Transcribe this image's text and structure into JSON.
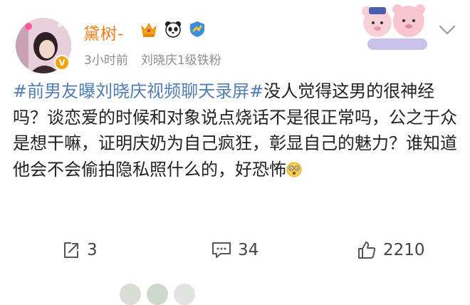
{
  "user": {
    "name": "黛树-",
    "time": "3小时前",
    "fan_label": "刘晓庆1级铁粉"
  },
  "post": {
    "hashtag": "#前男友曝刘晓庆视频聊天录屏#",
    "body": "没人觉得这男的很神经吗？谈恋爱的时候和对象说点烧话不是很正常吗，公之于众是想干嘛，证明庆奶为自己疯狂，彰显自己的魅力？谁知道他会不会偷拍隐私照什么的，好恐怖"
  },
  "actions": {
    "share_count": "3",
    "comment_count": "34",
    "like_count": "2210"
  },
  "icons": [
    "crown-icon",
    "panda-icon",
    "verified-shield-icon",
    "chevron-down-icon",
    "share-icon",
    "comment-icon",
    "like-icon",
    "dizzy-face-icon"
  ],
  "colors": {
    "username": "#f07d18",
    "hashtag": "#4f7cb4",
    "meta": "#8d8d8d"
  }
}
